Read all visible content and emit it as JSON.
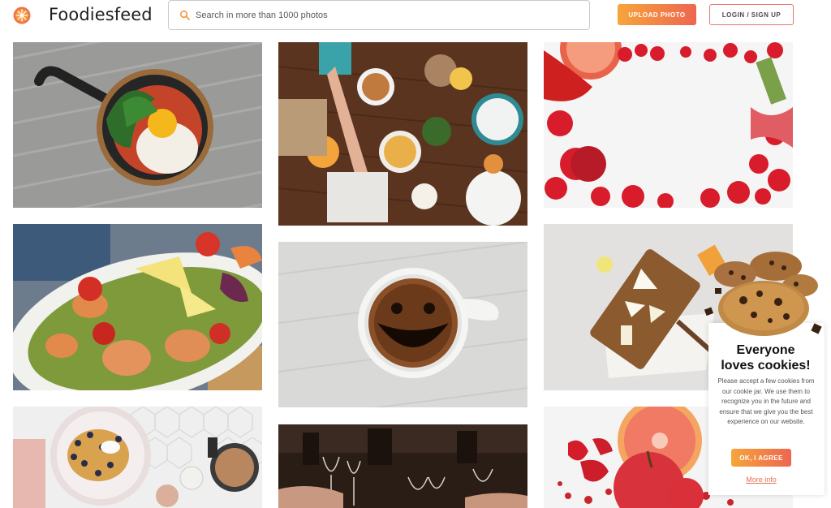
{
  "header": {
    "brand": "Foodiesfeed",
    "search_placeholder": "Search in more than 1000 photos",
    "upload_label": "UPLOAD PHOTO",
    "login_label": "LOGIN / SIGN UP"
  },
  "colors": {
    "accent_start": "#f6a53b",
    "accent_end": "#ee6650",
    "link": "#e7704f"
  },
  "photos": [
    "skillet-egg-spinach-photo",
    "dinner-table-overhead-photo",
    "red-fruit-frame-photo",
    "salmon-salad-lemon-photo",
    "smiling-coffee-cup-photo",
    "cheese-board-photo",
    "pancakes-coffee-photo",
    "wine-toast-photo",
    "grapefruit-apple-photo"
  ],
  "cookie": {
    "title_line1": "Everyone",
    "title_line2": "loves cookies!",
    "text": "Please accept a few cookies from our cookie jar. We use them to recognize you in the future and ensure that we give you the best experience on our website.",
    "agree_label": "OK, I AGREE",
    "more_info_label": "More info"
  }
}
